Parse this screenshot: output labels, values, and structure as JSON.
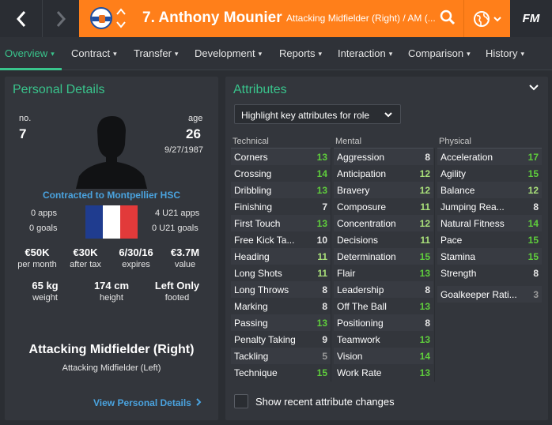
{
  "header": {
    "title": "7. Anthony Mounier",
    "subtitle": "Attacking Midfielder (Right) / AM (...",
    "logo": "FM"
  },
  "tabs": [
    {
      "label": "Overview"
    },
    {
      "label": "Contract"
    },
    {
      "label": "Transfer"
    },
    {
      "label": "Development"
    },
    {
      "label": "Reports"
    },
    {
      "label": "Interaction"
    },
    {
      "label": "Comparison"
    },
    {
      "label": "History"
    }
  ],
  "personal": {
    "title": "Personal Details",
    "no_label": "no.",
    "no_value": "7",
    "age_label": "age",
    "age_value": "26",
    "dob": "9/27/1987",
    "contract": "Contracted to Montpellier HSC",
    "apps": "0 apps",
    "goals": "0 goals",
    "u21_apps": "4 U21 apps",
    "u21_goals": "0 U21 goals",
    "stats": [
      {
        "value": "€50K",
        "label": "per month"
      },
      {
        "value": "€30K",
        "label": "after tax"
      },
      {
        "value": "6/30/16",
        "label": "expires"
      },
      {
        "value": "€3.7M",
        "label": "value"
      }
    ],
    "physical": [
      {
        "value": "65 kg",
        "label": "weight"
      },
      {
        "value": "174 cm",
        "label": "height"
      },
      {
        "value": "Left Only",
        "label": "footed"
      }
    ],
    "position_main": "Attacking Midfielder (Right)",
    "position_sub": "Attacking Midfielder (Left)",
    "view_link": "View Personal Details"
  },
  "attributes": {
    "title": "Attributes",
    "highlight_label": "Highlight key attributes for role",
    "show_recent": "Show recent attribute changes",
    "colors": {
      "high": "#5fce3c",
      "mid": "#a9e07a",
      "low": "#e8e8e8",
      "dim": "#9a9a9a"
    },
    "columns": [
      {
        "heading": "Technical",
        "items": [
          {
            "name": "Corners",
            "value": "13"
          },
          {
            "name": "Crossing",
            "value": "14"
          },
          {
            "name": "Dribbling",
            "value": "13"
          },
          {
            "name": "Finishing",
            "value": "7"
          },
          {
            "name": "First Touch",
            "value": "13"
          },
          {
            "name": "Free Kick Ta...",
            "value": "10"
          },
          {
            "name": "Heading",
            "value": "11"
          },
          {
            "name": "Long Shots",
            "value": "11"
          },
          {
            "name": "Long Throws",
            "value": "8"
          },
          {
            "name": "Marking",
            "value": "8"
          },
          {
            "name": "Passing",
            "value": "13"
          },
          {
            "name": "Penalty Taking",
            "value": "9"
          },
          {
            "name": "Tackling",
            "value": "5"
          },
          {
            "name": "Technique",
            "value": "15"
          }
        ]
      },
      {
        "heading": "Mental",
        "items": [
          {
            "name": "Aggression",
            "value": "8"
          },
          {
            "name": "Anticipation",
            "value": "12"
          },
          {
            "name": "Bravery",
            "value": "12"
          },
          {
            "name": "Composure",
            "value": "11"
          },
          {
            "name": "Concentration",
            "value": "12"
          },
          {
            "name": "Decisions",
            "value": "11"
          },
          {
            "name": "Determination",
            "value": "15"
          },
          {
            "name": "Flair",
            "value": "13"
          },
          {
            "name": "Leadership",
            "value": "8"
          },
          {
            "name": "Off The Ball",
            "value": "13"
          },
          {
            "name": "Positioning",
            "value": "8"
          },
          {
            "name": "Teamwork",
            "value": "13"
          },
          {
            "name": "Vision",
            "value": "14"
          },
          {
            "name": "Work Rate",
            "value": "13"
          }
        ]
      },
      {
        "heading": "Physical",
        "items": [
          {
            "name": "Acceleration",
            "value": "17"
          },
          {
            "name": "Agility",
            "value": "15"
          },
          {
            "name": "Balance",
            "value": "12"
          },
          {
            "name": "Jumping Rea...",
            "value": "8"
          },
          {
            "name": "Natural Fitness",
            "value": "14"
          },
          {
            "name": "Pace",
            "value": "15"
          },
          {
            "name": "Stamina",
            "value": "15"
          },
          {
            "name": "Strength",
            "value": "8"
          },
          {
            "name": "Goalkeeper Rati...",
            "value": "3"
          }
        ]
      }
    ]
  }
}
